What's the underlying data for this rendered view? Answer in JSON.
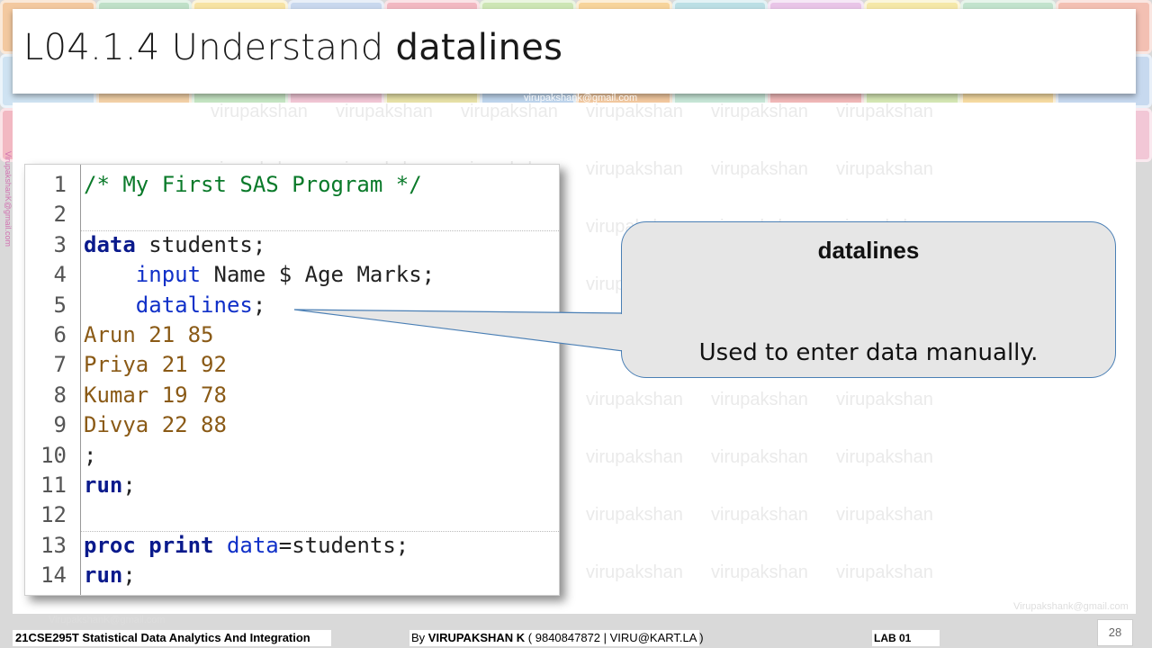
{
  "slide": {
    "title_prefix": "L04.1.4 Understand ",
    "title_keyword": "datalines",
    "watermark": "virupakshan",
    "email": "VirupakshanK@gmail.com",
    "email_top": "virupakshank@gmail.com",
    "email_bottom_right": "Virupakshank@gmail.com"
  },
  "code": {
    "lines": [
      {
        "n": "1",
        "parts": [
          {
            "t": "/* My First SAS Program */",
            "c": "c-comment"
          }
        ]
      },
      {
        "n": "2",
        "parts": []
      },
      {
        "n": "3",
        "parts": [
          {
            "t": "data",
            "c": "c-kw"
          },
          {
            "t": " students;",
            "c": "c-txt"
          }
        ]
      },
      {
        "n": "4",
        "parts": [
          {
            "t": "    ",
            "c": "c-txt"
          },
          {
            "t": "input",
            "c": "c-kw2"
          },
          {
            "t": " Name $ Age Marks;",
            "c": "c-txt"
          }
        ]
      },
      {
        "n": "5",
        "parts": [
          {
            "t": "    ",
            "c": "c-txt"
          },
          {
            "t": "datalines",
            "c": "c-kw2"
          },
          {
            "t": ";",
            "c": "c-txt"
          }
        ]
      },
      {
        "n": "6",
        "parts": [
          {
            "t": "Arun 21 85",
            "c": "c-data"
          }
        ]
      },
      {
        "n": "7",
        "parts": [
          {
            "t": "Priya 21 92",
            "c": "c-data"
          }
        ]
      },
      {
        "n": "8",
        "parts": [
          {
            "t": "Kumar 19 78",
            "c": "c-data"
          }
        ]
      },
      {
        "n": "9",
        "parts": [
          {
            "t": "Divya 22 88",
            "c": "c-data"
          }
        ]
      },
      {
        "n": "10",
        "parts": [
          {
            "t": ";",
            "c": "c-txt"
          }
        ]
      },
      {
        "n": "11",
        "parts": [
          {
            "t": "run",
            "c": "c-kw"
          },
          {
            "t": ";",
            "c": "c-txt"
          }
        ]
      },
      {
        "n": "12",
        "parts": []
      },
      {
        "n": "13",
        "parts": [
          {
            "t": "proc print",
            "c": "c-kw"
          },
          {
            "t": " ",
            "c": "c-txt"
          },
          {
            "t": "data",
            "c": "c-kw2"
          },
          {
            "t": "=students;",
            "c": "c-txt"
          }
        ]
      },
      {
        "n": "14",
        "parts": [
          {
            "t": "run",
            "c": "c-kw"
          },
          {
            "t": ";",
            "c": "c-txt"
          }
        ]
      }
    ]
  },
  "callout": {
    "title": "datalines",
    "description": "Used to enter data manually."
  },
  "footer": {
    "course": "21CSE295T Statistical Data Analytics And Integration",
    "author_prefix": "By ",
    "author_name": "VIRUPAKSHAN K",
    "author_contact": " ( 9840847872 | VIRU@KART.LA )",
    "lab": "LAB  01",
    "page": "28"
  }
}
